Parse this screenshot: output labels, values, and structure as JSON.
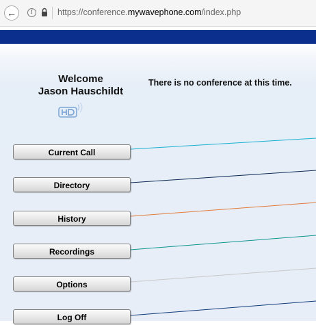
{
  "browser": {
    "url_prefix": "https://conference.",
    "url_domain": "mywavephone.com",
    "url_path": "/index.php",
    "icons": [
      "back-arrow-icon",
      "info-icon",
      "lock-icon"
    ]
  },
  "header": {
    "welcome": "Welcome",
    "user_name": "Jason Hauschildt",
    "logo": "hd-voice-logo",
    "status": "There is no conference at this time."
  },
  "menu": [
    {
      "label": "Current Call",
      "line_color": "#1ab0d0"
    },
    {
      "label": "Directory",
      "line_color": "#0e2a55"
    },
    {
      "label": "History",
      "line_color": "#e07b3a"
    },
    {
      "label": "Recordings",
      "line_color": "#0f9490"
    },
    {
      "label": "Options",
      "line_color": "#c8c8c8"
    },
    {
      "label": "Log Off",
      "line_color": "#0e3a7a"
    }
  ],
  "colors": {
    "header_band": "#0a2f8c"
  }
}
